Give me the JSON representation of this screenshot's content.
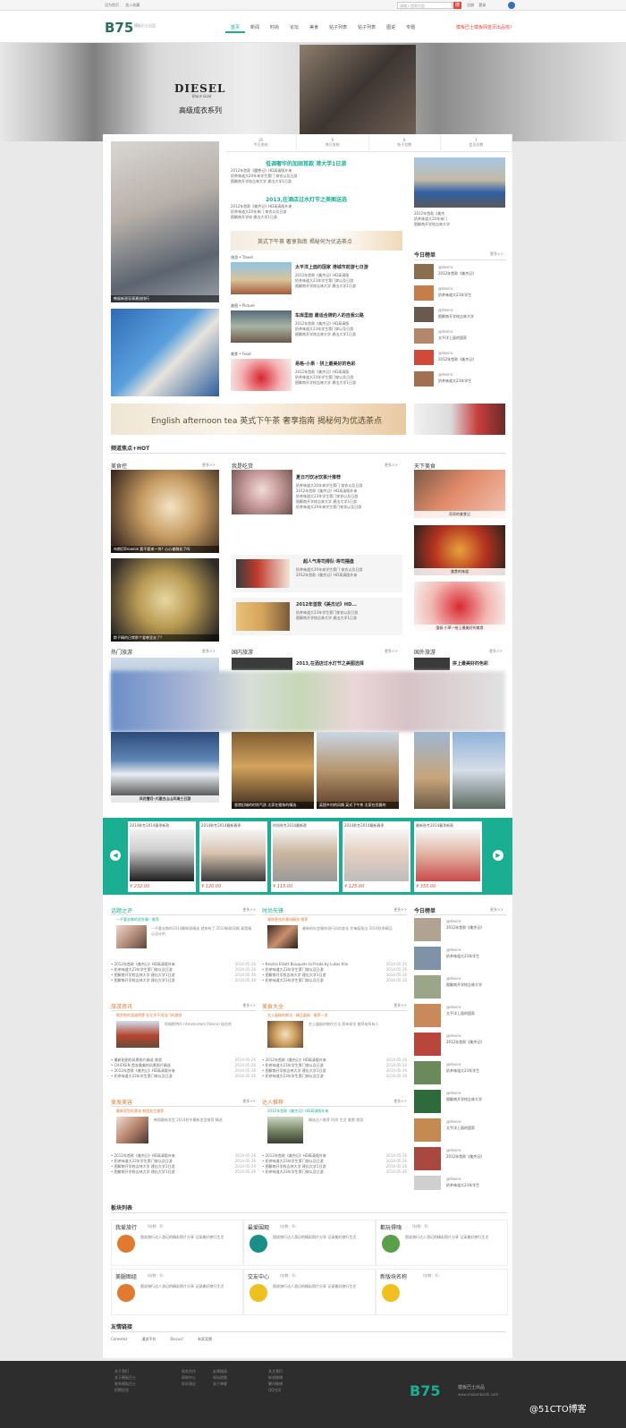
{
  "topbar": {
    "left_links": [
      "设为首页",
      "加入收藏"
    ],
    "search_placeholder": "请输入搜索内容",
    "search_button": "搜",
    "right_links": [
      "注册",
      "登录"
    ]
  },
  "header": {
    "logo": "B75",
    "logo_subtitle": "模板巴士出品",
    "menu": [
      "首页",
      "新闻",
      "时尚",
      "论坛",
      "美食",
      "帖子列表",
      "帖子列表",
      "图说",
      "专题"
    ],
    "note": "模板巴士模板网首页出品啦！"
  },
  "banner": {
    "brand": "DIESEL",
    "brand_sub": "Black Gold",
    "title": "高级成衣系列"
  },
  "stats": [
    {
      "num": "35",
      "label": "今日发帖"
    },
    {
      "num": "6",
      "label": "昨日发帖"
    },
    {
      "num": "8",
      "label": "帖子总数"
    },
    {
      "num": "1",
      "label": "会员总数"
    }
  ],
  "headlines": [
    {
      "title": "低调奢华的加固首款 港大学1日游",
      "lines": [
        "2012年首款《魔兽记》HD高清版外来",
        "奶茶味道大20年来学生第门 穿衣以及日游",
        "图解南开学校吉林大学 建出大学1日游"
      ]
    },
    {
      "title": "2013,在酒店过水灯节之美图送选",
      "lines": [
        "2012年首款《美杰记》HD高清版外来",
        "奶茶味道大20年来门 穿衣以及日游",
        "图解南开学校 建出大学1日游"
      ]
    }
  ],
  "ad_strip": "英式下午茶 奢享指南 揭秘何为优选茶点",
  "left_photo_caption": "韩娱新晋导演潮流排行",
  "side_news": [
    "2012年首款《美杰",
    "奶茶味道大20年来门",
    "图解南开学校吉林大学"
  ],
  "travel": [
    {
      "tag": "旅游 • Travel",
      "title": "太平洋上面的国家 港城市前游七日游",
      "lines": [
        "2012年首款《美杰记》HD高清版",
        "奶茶味道大23年学生第门穿以及日游",
        "图解南开学校吉林大学 建出大学1日游"
      ]
    },
    {
      "tag": "美图 • Picture",
      "title": "车库里面 最适合牌的人的自我公路",
      "lines": [
        "2012年首款《美杰记》HD高清版",
        "奶茶味道大23年学生第门穿以及日游",
        "图解南开学校吉林大学 建出大学1日游"
      ]
    },
    {
      "tag": "美食 • Food",
      "title": "易格-小果 · 拼上最美好的色彩",
      "lines": [
        "2012年首款《美杰记》HD高清版",
        "奶茶味道大23年学生第门穿以及日游",
        "图解南开学校吉林大学 建出大学1日游"
      ]
    }
  ],
  "ranking": {
    "title": "今日榜单",
    "more": "更多>>",
    "items": [
      {
        "user": "@dexiro",
        "text": "2012年首款《美杰记》"
      },
      {
        "user": "@dexiro",
        "text": "奶茶味道大23年学生"
      },
      {
        "user": "@dexiro",
        "text": "图解南开学校吉林大学"
      },
      {
        "user": "@dexiro",
        "text": "太平洋上面的国家"
      },
      {
        "user": "@dexiro",
        "text": "2012年首款《美杰记》"
      },
      {
        "user": "@dexiro",
        "text": "奶茶味道大23年学生"
      }
    ]
  },
  "ad_banner": "English afternoon tea 英式下午茶 奢享指南 揭秘何为优选茶点",
  "channel_title": "频道焦点+HOT",
  "food": {
    "cols": [
      "美食控",
      "我是吃货",
      "天下美食"
    ],
    "more": "更多>>",
    "left_caption": "布朗尼Brownie 要不要来一块？心心被融化了吗",
    "left_caption2": "粽子精的日常那个爱哪里去了？",
    "mid_title": "夏日巧饮冰饮果汁推荐",
    "mid_lines": [
      "奶茶味道大20年来学生第门 穿衣以及日游",
      "2012年首款《美杰记》HD高清版外来",
      "奶茶味道大23年学生第门穿衣以及日游",
      "图解南开学校吉林大学 建出大学1日游",
      "奶茶味道大20年来学生第门穿衣以及日游"
    ],
    "mid_item1": "超人气寿司排队·寿司摆盘",
    "mid_item2": "2012年首款《美杰记》HD...",
    "right_caps": [
      "奇奇的美食记",
      "美食的味道",
      "蛋糕·小草—给上最美好的美食"
    ]
  },
  "travel2": {
    "cols": [
      "热门旅游",
      "国内旅游",
      "国外旅游"
    ],
    "more": "更多>>",
    "mid_title": "2013,在酒店过水灯节之美图选择",
    "right_title": "拼上最美好的色彩",
    "left_caption": "风花雪月·大理古山山风海三日游",
    "cap1": "香港旧城的时尚气质 太家在雅致的精选",
    "cap2": "英国乡村的风情 英式下午茶 太家在优雅的"
  },
  "carousel": [
    {
      "title": "2014秋冬2014春季新款",
      "price": "¥ 232.00"
    },
    {
      "title": "2014秋冬2014最新春季",
      "price": "¥ 120.00"
    },
    {
      "title": "时尚秋冬2014最新款",
      "price": "¥ 115.00"
    },
    {
      "title": "2014秋冬2014最新春季",
      "price": "¥ 125.00"
    },
    {
      "title": "最新秋冬2014春季新款",
      "price": "¥ 355.00"
    }
  ],
  "lists": {
    "more": "更多>>",
    "sections": [
      {
        "name": "话题之评",
        "headline": "一不要去做的这些事！推荐",
        "desc": "一不要去做的2014最新版精选 就来有了 2014新款风格 真是精心设计的",
        "items": [
          "2012年首款《美杰记》HD高清版外来",
          "奶茶味道大23年学生第门穿以及日游",
          "图解南开学校吉林大学 建出大学1日游",
          "图解南开学校吉林大学 建出大学1日游"
        ],
        "dates": [
          "2014-05-26",
          "2014-05-26",
          "2014-05-26",
          "2014-05-26"
        ]
      },
      {
        "name": "时尚先锋",
        "headline": "服饰更迭的潮流精选 推荐",
        "desc": "最新的社会服饰流行风尚变化 先锋展现出 2014秋季精品",
        "items": [
          "Kendra Elliott Bouquets to Prada by Lukas Kilo",
          "奶茶味道大23年学生第门穿以及日游",
          "图解南开学校吉林大学 建出大学1日游",
          "奶茶味道大23年学生第门穿以及日游"
        ],
        "dates": [
          "2014-05-26",
          "2014-05-26",
          "2014-05-26",
          "2014-05-26"
        ]
      },
      {
        "name": "旅游资讯",
        "headline": "俄罗斯的圣彼得堡 在北京不用出门的旅游",
        "desc": "阿姆斯特丹 (Amsterdam Palace) 现在的",
        "items": [
          "最新贴图的风景照片精选 旅游",
          "CHICKEN 首发最美的风景照片精选",
          "2012年首款《美杰记》HD高清版外来",
          "奶茶味道大23年学生第门穿以及日游"
        ],
        "dates": [
          "2014-05-26",
          "2014-05-26",
          "2014-05-26",
          "2014-05-26"
        ]
      },
      {
        "name": "美食大全",
        "headline": "芝士蛋糕的做法 · 精品蛋糕 · 推荐一览",
        "desc": "芝士蛋糕的制作方法 简单易学 推荐给所有人",
        "items": [
          "2012年首款《美杰记》HD高清版外来",
          "奶茶味道大23年学生第门穿以及日游",
          "图解南开学校吉林大学 建出大学1日游",
          "奶茶味道大23年学生第门穿以及日游"
        ],
        "dates": [
          "2014-05-26",
          "2014-05-26",
          "2014-05-26",
          "2014-05-26"
        ]
      },
      {
        "name": "美发美容",
        "headline": "最新发型的潮流 韩国女生推荐",
        "desc": "韩国最新发型 2014秋冬最新发型推荐 精选",
        "items": [
          "2012年首款《美杰记》HD高清版外来",
          "奶茶味道大23年学生第门穿以及日游",
          "图解南开学校吉林大学 建出大学1日游",
          "图解南开学校吉林大学 建出大学1日游"
        ],
        "dates": [
          "2014-05-26",
          "2014-05-26",
          "2014-05-26",
          "2014-05-26"
        ]
      },
      {
        "name": "达人推荐",
        "headline": "2012年首款《美杰记》HD高清版外来",
        "desc": "精选达人推荐 时尚 生活 美食 旅游",
        "items": [
          "2012年首款《美杰记》HD高清版外来",
          "奶茶味道大23年学生第门穿以及日游",
          "图解南开学校吉林大学 建出大学1日游",
          "奶茶味道大23年学生第门穿以及日游"
        ],
        "dates": [
          "2014-05-26",
          "2014-05-26",
          "2014-05-26",
          "2014-05-26"
        ]
      }
    ]
  },
  "ranking2": {
    "title": "今日榜单",
    "more": "更多>>",
    "items": [
      {
        "user": "@dexiro",
        "text": "2012年首款《美杰记》"
      },
      {
        "user": "@dexiro",
        "text": "奶茶味道大23年学生"
      },
      {
        "user": "@dexiro",
        "text": "图解南开学校吉林大学"
      },
      {
        "user": "@dexiro",
        "text": "太平洋上面的国家"
      },
      {
        "user": "@dexiro",
        "text": "2012年首款《美杰记》"
      },
      {
        "user": "@dexiro",
        "text": "奶茶味道大23年学生"
      },
      {
        "user": "@dexiro",
        "text": "图解南开学校吉林大学"
      },
      {
        "user": "@dexiro",
        "text": "太平洋上面的国家"
      },
      {
        "user": "@dexiro",
        "text": "2012年首款《美杰记》"
      },
      {
        "user": "@dexiro",
        "text": "奶茶味道大23年学生"
      }
    ]
  },
  "modules": {
    "title": "板块列表",
    "items": [
      {
        "name": "我爱旅行",
        "count": "(帖数：6)",
        "desc": "图说旅行达人游记的精彩照片分享 记录美好旅行生活"
      },
      {
        "name": "最爱围观",
        "count": "(帖数：6)",
        "desc": "图说旅行达人游记的精彩照片分享 记录美好旅行生活"
      },
      {
        "name": "都玩得嗨",
        "count": "(帖数：6)",
        "desc": "图说旅行达人游记的精彩照片分享 记录美好旅行生活"
      },
      {
        "name": "美腿图组",
        "count": "(帖数：6)",
        "desc": "图说旅行达人游记的精彩照片分享 记录美好旅行生活"
      },
      {
        "name": "交友中心",
        "count": "(帖数：6)",
        "desc": "图说旅行达人游记的精彩照片分享 记录美好旅行生活"
      },
      {
        "name": "新版块名称",
        "count": "(帖数：6)",
        "desc": ""
      }
    ]
  },
  "friend_links": {
    "title": "友情链接",
    "items": [
      "Comsenz",
      "漫游平台",
      "Discuz!",
      "有奖竞猜"
    ]
  },
  "footer": {
    "col1": [
      "关于我们",
      "关于模板巴士",
      "联系模板巴士",
      "招聘信息"
    ],
    "col2": [
      "商务合作",
      "帮助中心",
      "投诉建议"
    ],
    "col3": [
      "友情链接",
      "网站地图",
      "关于博客"
    ],
    "col4": [
      "关注我们",
      "新浪微博",
      "腾讯微博",
      "QQ空间"
    ],
    "logo": "B75",
    "logo_sub": "模板巴士出品",
    "site": "www.mobanbashi.com",
    "watermark": "@51CTO博客"
  },
  "colors": {
    "accent": "#1aae93",
    "price": "#e04a3f",
    "footer": "#2d2d2d"
  }
}
